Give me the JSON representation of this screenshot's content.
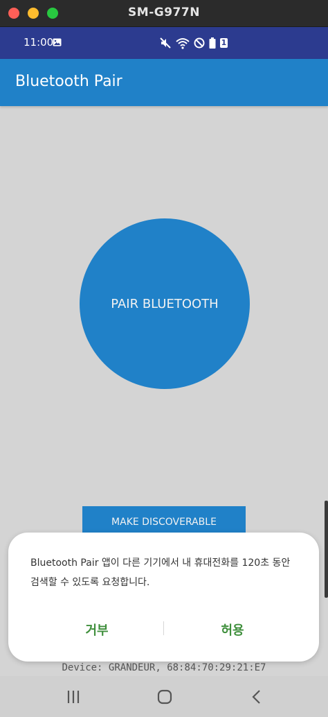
{
  "window": {
    "title": "SM-G977N"
  },
  "status_bar": {
    "time": "11:00",
    "notification_count": "1",
    "icons": [
      "image-icon",
      "mute-icon",
      "wifi-icon",
      "do-not-disturb-icon",
      "battery-icon"
    ]
  },
  "app_bar": {
    "title": "Bluetooth Pair"
  },
  "main": {
    "pair_button_label": "PAIR BLUETOOTH",
    "discoverable_button_label": "MAKE DISCOVERABLE",
    "device_info": "Device: GRANDEUR, 68:84:70:29:21:E7"
  },
  "dialog": {
    "message": "Bluetooth Pair 앱이 다른 기기에서 내 휴대전화를 120초 동안 검색할 수 있도록 요청합니다.",
    "deny_label": "거부",
    "allow_label": "허용"
  },
  "nav_bar": {
    "icons": [
      "recents-icon",
      "home-icon",
      "back-icon"
    ]
  },
  "colors": {
    "accent": "#2081c8",
    "status_bar": "#2c3b8f",
    "dialog_button": "#3f8f3c",
    "background": "#d4d4d4"
  }
}
